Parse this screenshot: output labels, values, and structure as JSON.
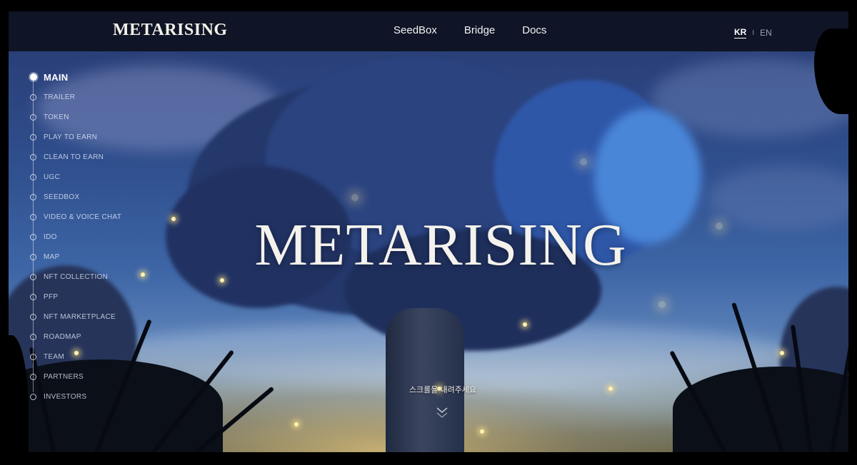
{
  "header": {
    "logo": "METARISING",
    "nav": [
      "SeedBox",
      "Bridge",
      "Docs"
    ],
    "lang_kr": "KR",
    "lang_sep": "I",
    "lang_en": "EN"
  },
  "sidebar": {
    "items": [
      {
        "label": "MAIN",
        "active": true
      },
      {
        "label": "TRAILER"
      },
      {
        "label": "TOKEN"
      },
      {
        "label": "PLAY TO EARN"
      },
      {
        "label": "CLEAN TO EARN"
      },
      {
        "label": "UGC"
      },
      {
        "label": "SEEDBOX"
      },
      {
        "label": "VIDEO & VOICE CHAT"
      },
      {
        "label": "IDO"
      },
      {
        "label": "MAP"
      },
      {
        "label": "NFT COLLECTION"
      },
      {
        "label": "PFP"
      },
      {
        "label": "NFT MARKETPLACE"
      },
      {
        "label": "ROADMAP"
      },
      {
        "label": "TEAM"
      },
      {
        "label": "PARTNERS"
      },
      {
        "label": "INVESTORS"
      }
    ]
  },
  "hero": {
    "title": "METARISING",
    "scroll_hint": "스크롤을 내려주세요"
  },
  "icons": {
    "scroll": "chevron-down-icon"
  },
  "colors": {
    "header_bg": "#0f1526",
    "sky": "#3e66a6",
    "text": "#f4f2ec"
  }
}
